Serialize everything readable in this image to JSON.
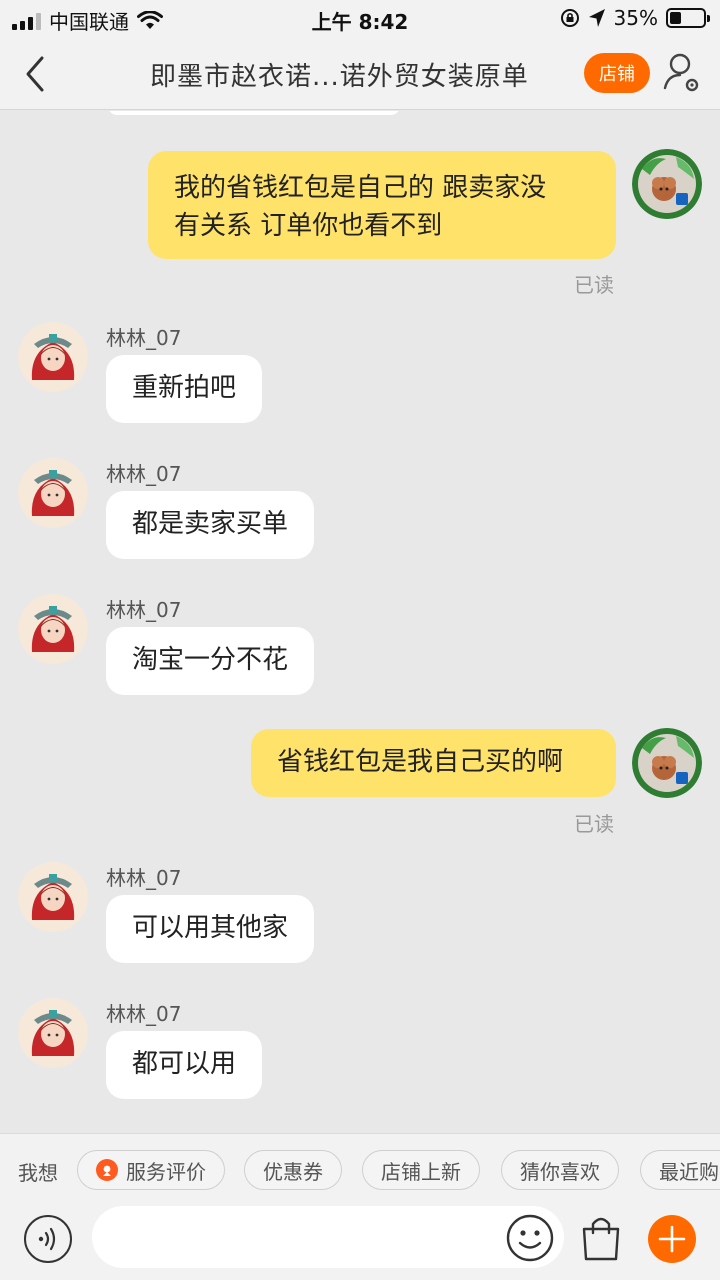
{
  "status_bar": {
    "carrier": "中国联通",
    "time": "上午 8:42",
    "battery": "35%",
    "battery_level": 0.35
  },
  "nav": {
    "title": "即墨市赵衣诺...诺外贸女装原单",
    "shop_label": "店铺"
  },
  "messages": [
    {
      "side": "out",
      "text_lines": [
        "我的省钱红包是自己的 跟卖家没",
        "有关系 订单你也看不到"
      ],
      "status": "已读"
    },
    {
      "side": "in",
      "sender": "林林_07",
      "text": "重新拍吧"
    },
    {
      "side": "in",
      "sender": "林林_07",
      "text": "都是卖家买单"
    },
    {
      "side": "in",
      "sender": "林林_07",
      "text": "淘宝一分不花"
    },
    {
      "side": "out",
      "text": "省钱红包是我自己买的啊",
      "status": "已读"
    },
    {
      "side": "in",
      "sender": "林林_07",
      "text": "可以用其他家"
    },
    {
      "side": "in",
      "sender": "林林_07",
      "text": "都可以用"
    }
  ],
  "suggestions": {
    "label": "我想",
    "chips": [
      "服务评价",
      "优惠券",
      "店铺上新",
      "猜你喜欢",
      "最近购"
    ]
  },
  "colors": {
    "accent": "#ff6a00",
    "out_bubble": "#ffe26a",
    "in_bubble": "#ffffff",
    "background": "#e8e8e8"
  }
}
